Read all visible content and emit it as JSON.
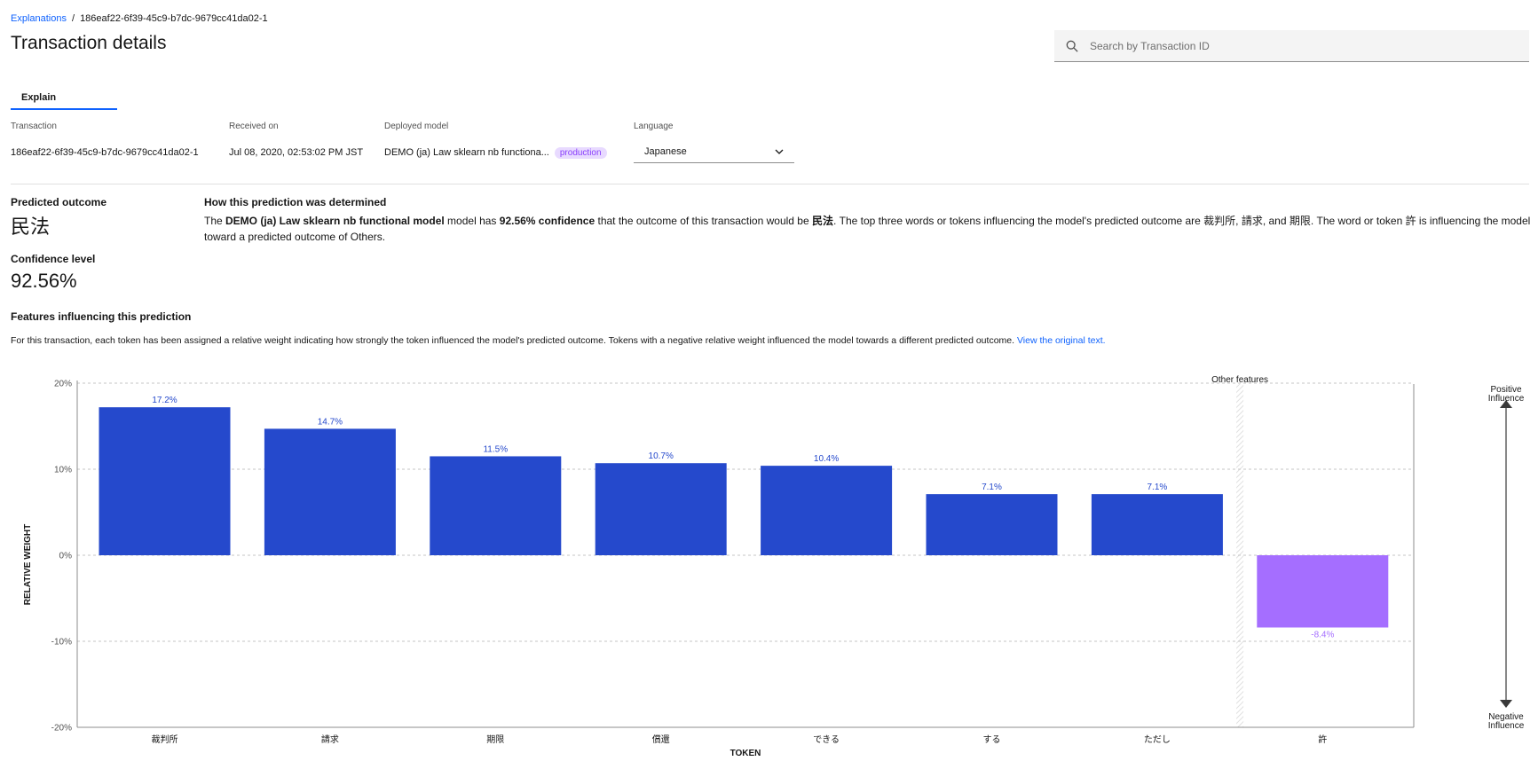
{
  "breadcrumb": {
    "parent": "Explanations",
    "separator": "/",
    "current": "186eaf22-6f39-45c9-b7dc-9679cc41da02-1"
  },
  "page_title": "Transaction details",
  "search": {
    "placeholder": "Search by Transaction ID",
    "value": "",
    "icon": "search-icon"
  },
  "tabs": [
    {
      "label": "Explain",
      "selected": true
    }
  ],
  "meta": {
    "transaction": {
      "label": "Transaction",
      "value": "186eaf22-6f39-45c9-b7dc-9679cc41da02-1"
    },
    "received": {
      "label": "Received on",
      "value": "Jul 08, 2020, 02:53:02 PM JST"
    },
    "model": {
      "label": "Deployed model",
      "value": "DEMO (ja) Law sklearn nb functiona...",
      "badge": "production"
    },
    "language": {
      "label": "Language",
      "value": "Japanese"
    }
  },
  "prediction": {
    "outcome_label": "Predicted outcome",
    "outcome_value": "民法",
    "confidence_label": "Confidence level",
    "confidence_value": "92.56%"
  },
  "explanation": {
    "heading": "How this prediction was determined",
    "t1": "The ",
    "model_name": "DEMO (ja) Law sklearn nb functional model",
    "t2": " model has ",
    "confidence": "92.56% confidence",
    "t3": " that the outcome of this transaction would be ",
    "outcome": "民法",
    "t4": ". The top three words or tokens influencing the model's predicted outcome are 裁判所, 請求, and 期限. The word or token 許 is influencing the model toward a predicted outcome of Others."
  },
  "features": {
    "heading": "Features influencing this prediction",
    "description": "For this transaction, each token has been assigned a relative weight indicating how strongly the token influenced the model's predicted outcome. Tokens with a negative relative weight influenced the model towards a different predicted outcome.",
    "link": "View the original text."
  },
  "colors": {
    "positive": "#2549cc",
    "negative": "#a56eff",
    "accent": "#0f62fe",
    "badge_bg": "#e8daff",
    "badge_fg": "#8a3ffc"
  },
  "chart_data": {
    "type": "bar",
    "categories": [
      "裁判所",
      "請求",
      "期限",
      "償還",
      "できる",
      "する",
      "ただし",
      "許"
    ],
    "values": [
      17.2,
      14.7,
      11.5,
      10.7,
      10.4,
      7.1,
      7.1,
      -8.4
    ],
    "value_labels": [
      "17.2%",
      "14.7%",
      "11.5%",
      "10.7%",
      "10.4%",
      "7.1%",
      "7.1%",
      "-8.4%"
    ],
    "group_label": "Other features",
    "other_features_index": 7,
    "xlabel": "TOKEN",
    "ylabel": "RELATIVE WEIGHT",
    "ylim": [
      -20,
      20
    ],
    "yticks": [
      20,
      10,
      0,
      -10,
      -20
    ],
    "ytick_labels": [
      "20%",
      "10%",
      "0%",
      "-10%",
      "-20%"
    ],
    "grid": true,
    "influence": {
      "positive": [
        "Positive",
        "Influence"
      ],
      "negative": [
        "Negative",
        "Influence"
      ]
    }
  }
}
